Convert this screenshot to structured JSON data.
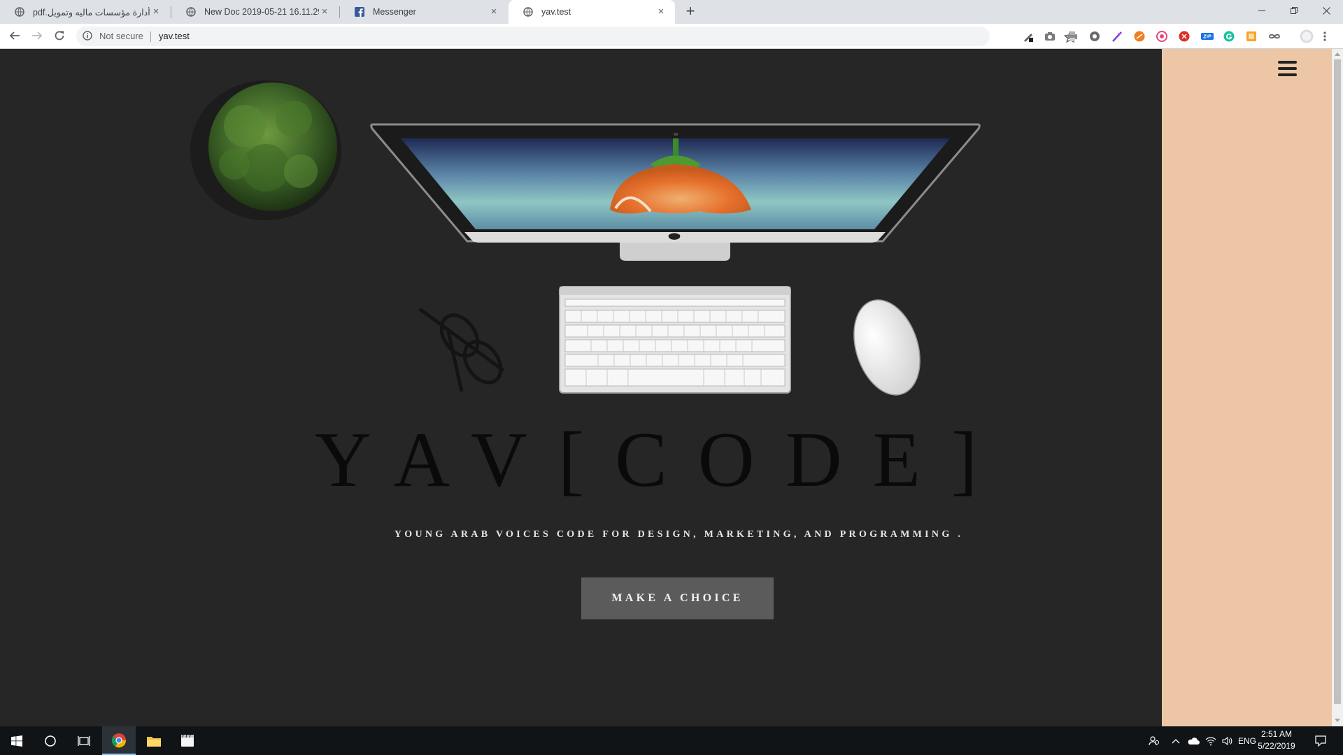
{
  "browser": {
    "tabs": [
      {
        "label": "أدارة مؤسسات ماليه وتمويل.pdf",
        "icon": "globe-icon",
        "active": false
      },
      {
        "label": "New Doc 2019-05-21 16.11.29",
        "icon": "globe-icon",
        "active": false
      },
      {
        "label": "Messenger",
        "icon": "facebook-icon",
        "active": false
      },
      {
        "label": "yav.test",
        "icon": "globe-icon",
        "active": true
      }
    ],
    "new_tab_glyph": "+",
    "close_glyph": "×",
    "window_controls": {
      "minimize": "—",
      "restore": "❐",
      "close": "✕"
    },
    "security_label": "Not secure",
    "url": "yav.test",
    "extensions": [
      "pen-tool-icon",
      "camera-icon",
      "printer-icon",
      "gear-extension-icon",
      "feather-icon",
      "orange-circle-icon",
      "pink-circle-icon",
      "red-close-icon",
      "zip-icon",
      "grammarly-icon",
      "orange-square-icon",
      "infinity-icon"
    ]
  },
  "site": {
    "logo": "YAV[CODE]",
    "tagline": "YOUNG ARAB VOICES CODE FOR DESIGN, MARKETING, AND PROGRAMMING .",
    "cta_label": "MAKE A CHOICE",
    "menu_icon": "hamburger-menu-icon"
  },
  "taskbar": {
    "language": "ENG",
    "time": "2:51 AM",
    "date": "5/22/2019"
  },
  "colors": {
    "page_background": "#262626",
    "side_panel": "#edc7a5",
    "button_background": "#5b5b5b",
    "logo_text": "#0a0a0a"
  }
}
